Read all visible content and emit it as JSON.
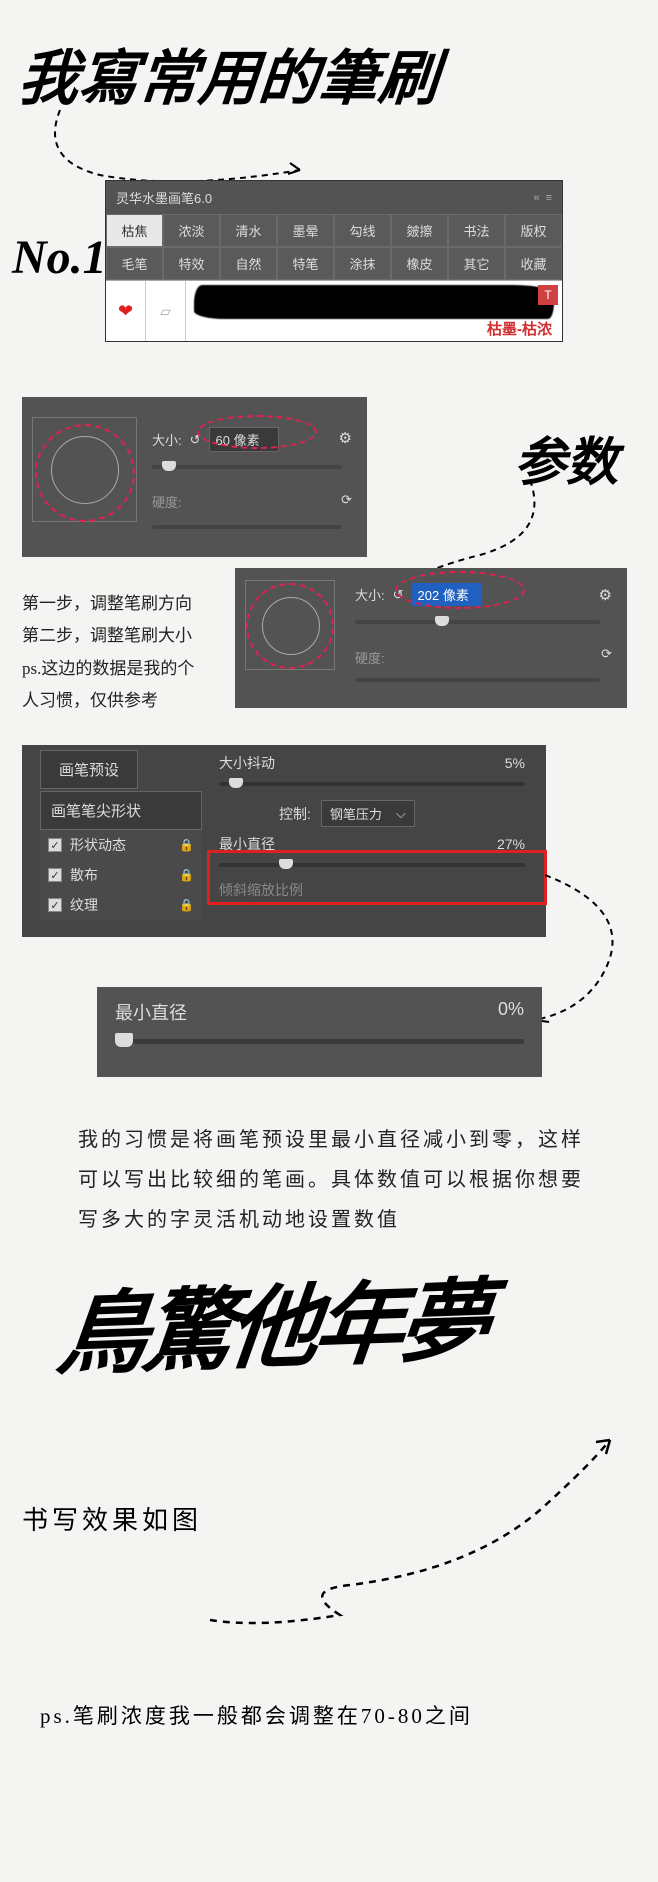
{
  "title_brush": "我寫常用的筆刷",
  "no1": "No.1",
  "params_label": "参数",
  "panel1": {
    "title": "灵华水墨画笔6.0",
    "tabs_row1": [
      "枯焦",
      "浓淡",
      "清水",
      "墨晕",
      "勾线",
      "皴擦",
      "书法",
      "版权"
    ],
    "tabs_row2": [
      "毛笔",
      "特效",
      "自然",
      "特笔",
      "涂抹",
      "橡皮",
      "其它",
      "收藏"
    ],
    "stroke_label": "枯墨-枯浓",
    "t_badge": "T"
  },
  "panel2": {
    "size_label": "大小:",
    "size_value": "60 像素",
    "hardness": "硬度:"
  },
  "steps": {
    "l1": "第一步，调整笔刷方向",
    "l2": "第二步，调整笔刷大小",
    "l3": "ps.这边的数据是我的个",
    "l4": "人习惯，仅供参考"
  },
  "panel3": {
    "size_label": "大小:",
    "size_value": "202 像素",
    "hardness": "硬度:"
  },
  "panel4": {
    "preset_tab": "画笔预设",
    "tip_shape": "画笔笔尖形状",
    "rows": [
      "形状动态",
      "散布",
      "纹理"
    ],
    "size_jitter": "大小抖动",
    "size_jitter_val": "5%",
    "control": "控制:",
    "control_val": "钢笔压力",
    "min_diam": "最小直径",
    "min_diam_val": "27%",
    "tilt": "倾斜缩放比例"
  },
  "panel5": {
    "label": "最小直径",
    "value": "0%"
  },
  "body_text": "我的习惯是将画笔预设里最小直径减小到零，这样可以写出比较细的笔画。具体数值可以根据你想要写多大的字灵活机动地设置数值",
  "big_brush": "鳥驚他年夢",
  "effect_label": "书写效果如图",
  "bottom_text": "ps.笔刷浓度我一般都会调整在70-80之间"
}
